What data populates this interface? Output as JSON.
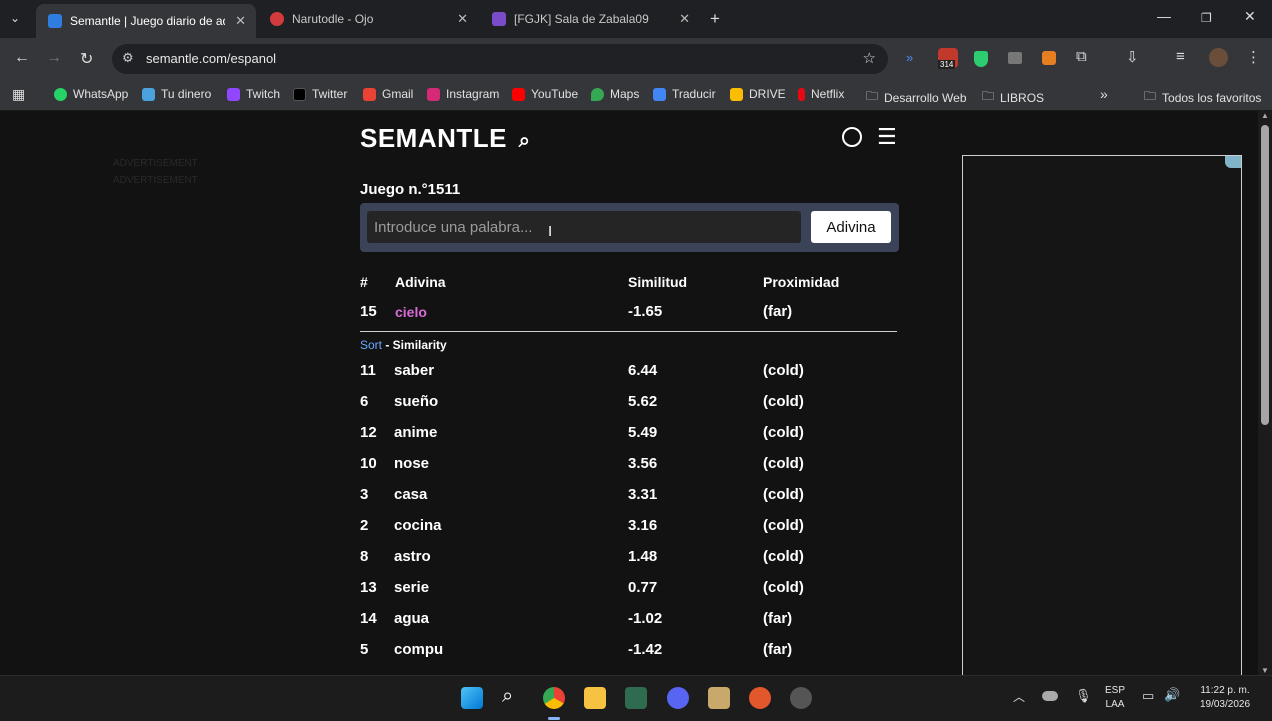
{
  "tabs": [
    {
      "title": "Semantle | Juego diario de adivinanza",
      "active": true,
      "color": "#2f7de1"
    },
    {
      "title": "Narutodle - Ojo",
      "active": false,
      "color": "#d13b3b"
    },
    {
      "title": "[FGJK] Sala de Zabala09",
      "active": false,
      "color": "#7b4cc9"
    }
  ],
  "address": {
    "url": "semantle.com/espanol"
  },
  "extension_badge": "314",
  "bookmarks": [
    {
      "label": "WhatsApp",
      "color": "#25d366"
    },
    {
      "label": "Tu dinero",
      "color": "#4aa3df"
    },
    {
      "label": "Twitch",
      "color": "#9146ff"
    },
    {
      "label": "Twitter",
      "color": "#000000"
    },
    {
      "label": "Gmail",
      "color": "#ea4335"
    },
    {
      "label": "Instagram",
      "color": "#d62976"
    },
    {
      "label": "YouTube",
      "color": "#ff0000"
    },
    {
      "label": "Maps",
      "color": "#34a853"
    },
    {
      "label": "Traducir",
      "color": "#4285f4"
    },
    {
      "label": "DRIVE",
      "color": "#fbbc04"
    },
    {
      "label": "Netflix",
      "color": "#e50914"
    },
    {
      "label": "Desarrollo Web",
      "color": "folder"
    },
    {
      "label": "LIBROS",
      "color": "folder"
    }
  ],
  "bookmarks_all": "Todos los favoritos",
  "page": {
    "logo": "SEMANTLE",
    "advertisement": "ADVERTISEMENT",
    "game_number": "Juego n.°1511",
    "input_placeholder": "Introduce una palabra...",
    "guess_button": "Adivina",
    "headers": {
      "num": "#",
      "guess": "Adivina",
      "similarity": "Similitud",
      "proximity": "Proximidad"
    },
    "latest": {
      "num": "15",
      "word": "cielo",
      "similarity": "-1.65",
      "proximity": "(far)"
    },
    "sort_link": "Sort",
    "sort_label": " - Similarity",
    "rows": [
      {
        "num": "11",
        "word": "saber",
        "similarity": "6.44",
        "proximity": "(cold)"
      },
      {
        "num": "6",
        "word": "sueño",
        "similarity": "5.62",
        "proximity": "(cold)"
      },
      {
        "num": "12",
        "word": "anime",
        "similarity": "5.49",
        "proximity": "(cold)"
      },
      {
        "num": "10",
        "word": "nose",
        "similarity": "3.56",
        "proximity": "(cold)"
      },
      {
        "num": "3",
        "word": "casa",
        "similarity": "3.31",
        "proximity": "(cold)"
      },
      {
        "num": "2",
        "word": "cocina",
        "similarity": "3.16",
        "proximity": "(cold)"
      },
      {
        "num": "8",
        "word": "astro",
        "similarity": "1.48",
        "proximity": "(cold)"
      },
      {
        "num": "13",
        "word": "serie",
        "similarity": "0.77",
        "proximity": "(cold)"
      },
      {
        "num": "14",
        "word": "agua",
        "similarity": "-1.02",
        "proximity": "(far)"
      },
      {
        "num": "5",
        "word": "compu",
        "similarity": "-1.42",
        "proximity": "(far)"
      }
    ]
  },
  "taskbar": {
    "lang": "ESP",
    "region": "LAA",
    "time": "11:22 p. m.",
    "date": "19/03/2026"
  }
}
